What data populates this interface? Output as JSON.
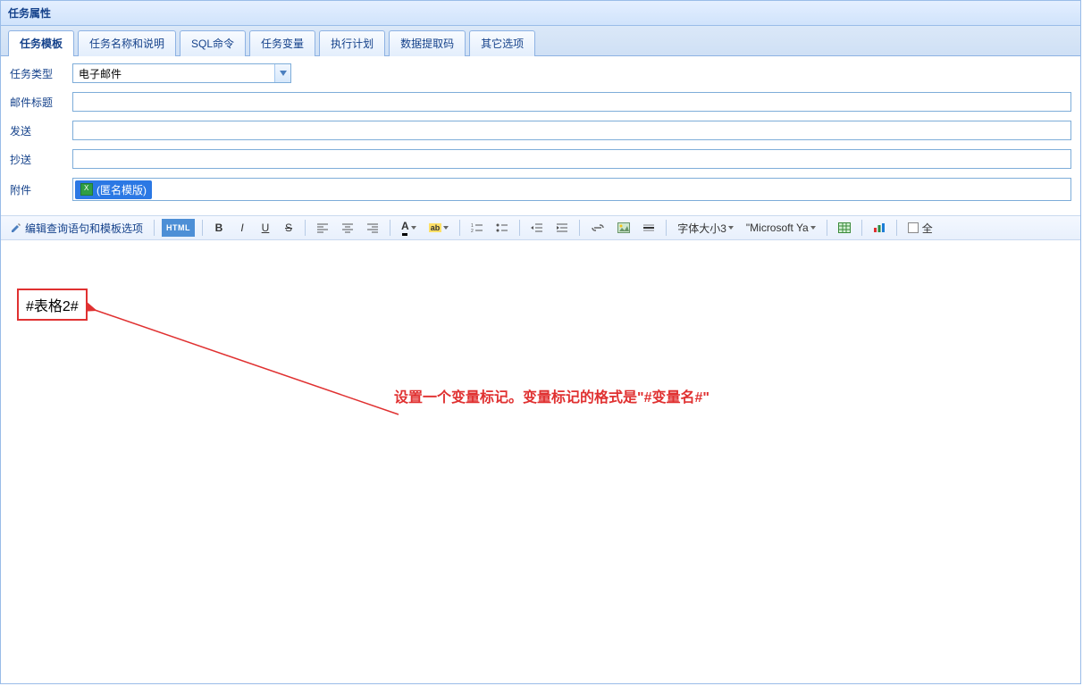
{
  "panel": {
    "title": "任务属性"
  },
  "tabs": [
    {
      "label": "任务模板",
      "active": true
    },
    {
      "label": "任务名称和说明"
    },
    {
      "label": "SQL命令"
    },
    {
      "label": "任务变量"
    },
    {
      "label": "执行计划"
    },
    {
      "label": "数据提取码"
    },
    {
      "label": "其它选项"
    }
  ],
  "form": {
    "type_label": "任务类型",
    "type_value": "电子邮件",
    "subject_label": "邮件标题",
    "subject_value": "",
    "to_label": "发送",
    "to_value": "",
    "cc_label": "抄送",
    "cc_value": "",
    "attach_label": "附件",
    "attach_chip": "(匿名模版)"
  },
  "toolbar": {
    "edit_label": "编辑查询语句和模板选项",
    "html_badge": "HTML",
    "font_size_label": "字体大小3",
    "font_family_label": "\"Microsoft Ya",
    "fullscreen_label": "全"
  },
  "editor": {
    "variable_marker": "#表格2#",
    "annotation": "设置一个变量标记。变量标记的格式是\"#变量名#\""
  }
}
